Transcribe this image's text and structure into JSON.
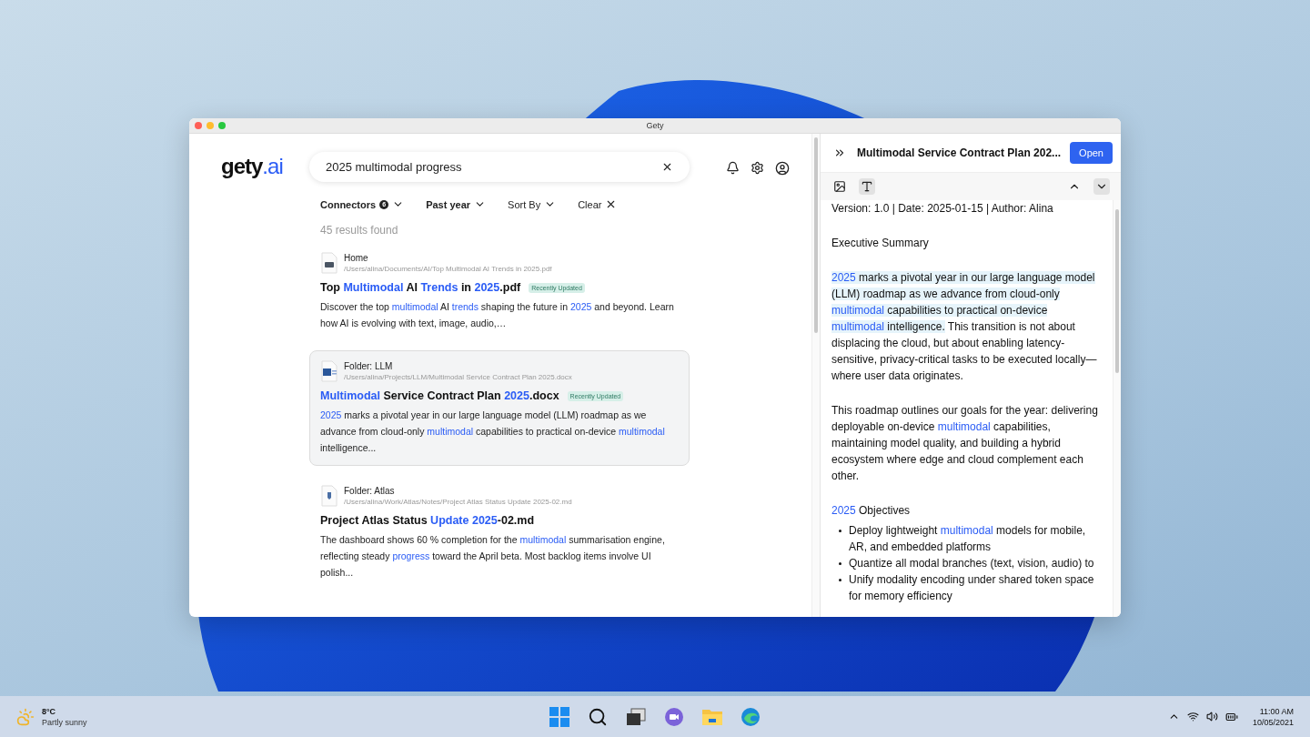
{
  "window": {
    "title": "Gety"
  },
  "logo": {
    "text": "gety",
    "suffix": ".ai"
  },
  "search": {
    "value": "2025 multimodal progress"
  },
  "filters": [
    {
      "kind": "dropdown",
      "label": "Connectors",
      "badge": "6",
      "active": true
    },
    {
      "kind": "dropdown",
      "label": "Past year",
      "active": true
    },
    {
      "kind": "dropdown",
      "label": "Sort By",
      "active": false
    },
    {
      "kind": "clear",
      "label": "Clear",
      "active": false
    }
  ],
  "results_count": "45 results found",
  "results": [
    {
      "kind": "pdf",
      "location": "Home",
      "path": "/Users/alina/Documents/AI/Top Multimodal AI Trends in 2025.pdf",
      "selected": false,
      "badge": "Recently Updated",
      "title": [
        {
          "text": "Top ",
          "match": false
        },
        {
          "text": "Multimodal",
          "match": true
        },
        {
          "text": " AI ",
          "match": false
        },
        {
          "text": "Trends",
          "match": true
        },
        {
          "text": " in ",
          "match": false
        },
        {
          "text": "2025",
          "match": true
        },
        {
          "text": ".pdf",
          "match": false
        }
      ],
      "snippet": [
        {
          "text": "Discover the top ",
          "match": false
        },
        {
          "text": "multimodal",
          "match": true
        },
        {
          "text": " AI ",
          "match": false
        },
        {
          "text": "trends",
          "match": true
        },
        {
          "text": " shaping the future in ",
          "match": false
        },
        {
          "text": "2025",
          "match": true
        },
        {
          "text": " and beyond. Learn how AI is evolving with text, image, audio,…",
          "match": false
        }
      ]
    },
    {
      "kind": "docx",
      "location": "Folder: LLM",
      "path": "/Users/alina/Projects/LLM/Multimodal Service Contract Plan 2025.docx",
      "selected": true,
      "badge": "Recently Updated",
      "title": [
        {
          "text": "Multimodal",
          "match": true
        },
        {
          "text": " Service Contract Plan ",
          "match": false
        },
        {
          "text": "2025",
          "match": true
        },
        {
          "text": ".docx",
          "match": false
        }
      ],
      "snippet": [
        {
          "text": "2025",
          "match": true
        },
        {
          "text": " marks a pivotal year in our large language model (LLM) roadmap as we advance from cloud-only ",
          "match": false
        },
        {
          "text": "multimodal",
          "match": true
        },
        {
          "text": " capabilities to practical on-device ",
          "match": false
        },
        {
          "text": "multimodal",
          "match": true
        },
        {
          "text": " intelligence...",
          "match": false
        }
      ]
    },
    {
      "kind": "md",
      "location": "Folder: Atlas",
      "path": "/Users/alina/Work/Atlas/Notes/Project Atlas Status Update 2025-02.md",
      "selected": false,
      "title": [
        {
          "text": "Project Atlas Status ",
          "match": false
        },
        {
          "text": "Update 2025",
          "match": true
        },
        {
          "text": "-02.md",
          "match": false
        }
      ],
      "snippet": [
        {
          "text": "The dashboard shows 60 % completion for the ",
          "match": false
        },
        {
          "text": "multimodal",
          "match": true
        },
        {
          "text": " summarisation engine, reflecting steady ",
          "match": false
        },
        {
          "text": "progress",
          "match": true
        },
        {
          "text": " toward the April beta. Most backlog items involve UI polish...",
          "match": false
        }
      ]
    }
  ],
  "preview": {
    "title": "Multimodal Service Contract Plan 202...",
    "open_button": "Open",
    "view_modes": [
      {
        "kind": "image",
        "selected": false
      },
      {
        "kind": "text",
        "selected": true
      }
    ],
    "blocks": [
      {
        "kind": "paragraph",
        "segments": [
          {
            "text": "Version: 1.0 | Date: 2025-01-15 | Author: Alina",
            "match": false,
            "current": false
          }
        ]
      },
      {
        "kind": "paragraph",
        "segments": [
          {
            "text": "Executive Summary",
            "match": false,
            "current": false
          }
        ]
      },
      {
        "kind": "paragraph",
        "segments": [
          {
            "text": "2025",
            "match": true,
            "current": true
          },
          {
            "text": " marks a pivotal year in our large language model (LLM) roadmap as we advance from cloud-only ",
            "match": false,
            "current": true
          },
          {
            "text": "multimodal",
            "match": true,
            "current": true
          },
          {
            "text": " capabilities to practical on-device ",
            "match": false,
            "current": true
          },
          {
            "text": "multimodal",
            "match": true,
            "current": true
          },
          {
            "text": " intelligence.",
            "match": false,
            "current": true
          },
          {
            "text": " This transition is not about displacing the cloud, but about enabling latency-sensitive, privacy-critical tasks to be executed locally—where user data originates.",
            "match": false,
            "current": false
          }
        ]
      },
      {
        "kind": "paragraph",
        "segments": [
          {
            "text": "This roadmap outlines our goals for the year: delivering deployable on-device ",
            "match": false,
            "current": false
          },
          {
            "text": "multimodal",
            "match": true,
            "current": false
          },
          {
            "text": " capabilities, maintaining model quality, and building a hybrid ecosystem where edge and cloud complement each other.",
            "match": false,
            "current": false
          }
        ]
      },
      {
        "kind": "heading",
        "segments": [
          {
            "text": "2025",
            "match": true,
            "current": false
          },
          {
            "text": " Objectives",
            "match": false,
            "current": false
          }
        ]
      },
      {
        "kind": "bullets",
        "items": [
          [
            {
              "text": "Deploy lightweight ",
              "match": false,
              "current": false
            },
            {
              "text": "multimodal",
              "match": true,
              "current": false
            },
            {
              "text": " models for mobile, AR, and embedded platforms",
              "match": false,
              "current": false
            }
          ],
          [
            {
              "text": "Quantize all modal branches (text, vision, audio) to",
              "match": false,
              "current": false
            }
          ],
          [
            {
              "text": "Unify modality encoding under shared token space for memory efficiency",
              "match": false,
              "current": false
            }
          ]
        ]
      }
    ]
  },
  "taskbar": {
    "weather": {
      "temp": "8°C",
      "condition": "Partly sunny"
    },
    "clock": {
      "time": "11:00 AM",
      "date": "10/05/2021"
    }
  }
}
